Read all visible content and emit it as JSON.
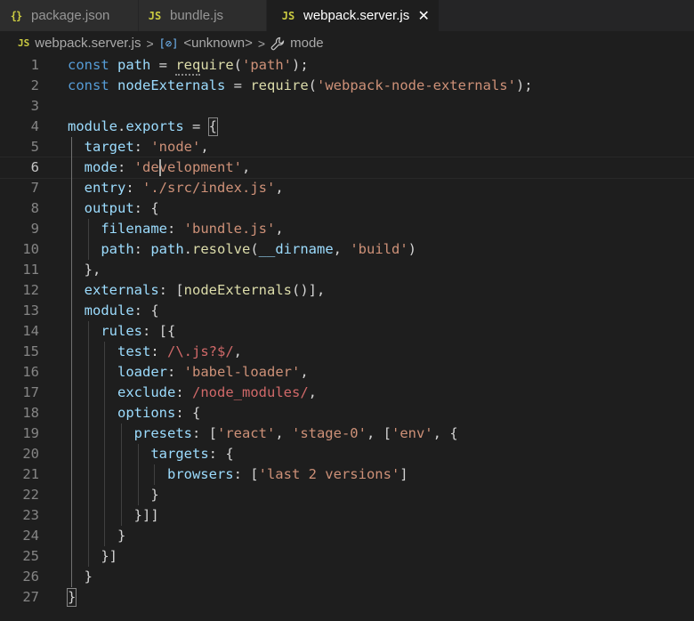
{
  "tabs": [
    {
      "icon": "{}",
      "label": "package.json",
      "active": false
    },
    {
      "icon": "JS",
      "label": "bundle.js",
      "active": false
    },
    {
      "icon": "JS",
      "label": "webpack.server.js",
      "active": true,
      "close": "✕"
    }
  ],
  "breadcrumb": {
    "file_icon": "JS",
    "file": "webpack.server.js",
    "symbol": "<unknown>",
    "property": "mode"
  },
  "editor": {
    "current_line": 6,
    "lines": [
      {
        "n": "1",
        "tokens": [
          [
            "kw",
            "const "
          ],
          [
            "var",
            "path"
          ],
          [
            "p",
            " = "
          ],
          [
            "fn",
            "require"
          ],
          [
            "p",
            "("
          ],
          [
            "str",
            "'path'"
          ],
          [
            "p",
            ");"
          ]
        ]
      },
      {
        "n": "2",
        "tokens": [
          [
            "kw",
            "const "
          ],
          [
            "var",
            "nodeExternals"
          ],
          [
            "p",
            " = "
          ],
          [
            "fn",
            "require"
          ],
          [
            "p",
            "("
          ],
          [
            "str",
            "'webpack-node-externals'"
          ],
          [
            "p",
            ");"
          ]
        ]
      },
      {
        "n": "3",
        "tokens": []
      },
      {
        "n": "4",
        "tokens": [
          [
            "var",
            "module"
          ],
          [
            "p",
            "."
          ],
          [
            "var",
            "exports"
          ],
          [
            "p",
            " = {"
          ]
        ]
      },
      {
        "n": "5",
        "tokens": [
          [
            "p",
            "  "
          ],
          [
            "var",
            "target"
          ],
          [
            "p",
            ": "
          ],
          [
            "str",
            "'node'"
          ],
          [
            "p",
            ","
          ]
        ]
      },
      {
        "n": "6",
        "tokens": [
          [
            "p",
            "  "
          ],
          [
            "var",
            "mode"
          ],
          [
            "p",
            ": "
          ],
          [
            "str",
            "'development'"
          ],
          [
            "p",
            ","
          ]
        ]
      },
      {
        "n": "7",
        "tokens": [
          [
            "p",
            "  "
          ],
          [
            "var",
            "entry"
          ],
          [
            "p",
            ": "
          ],
          [
            "str",
            "'./src/index.js'"
          ],
          [
            "p",
            ","
          ]
        ]
      },
      {
        "n": "8",
        "tokens": [
          [
            "p",
            "  "
          ],
          [
            "var",
            "output"
          ],
          [
            "p",
            ": {"
          ]
        ]
      },
      {
        "n": "9",
        "tokens": [
          [
            "p",
            "    "
          ],
          [
            "var",
            "filename"
          ],
          [
            "p",
            ": "
          ],
          [
            "str",
            "'bundle.js'"
          ],
          [
            "p",
            ","
          ]
        ]
      },
      {
        "n": "10",
        "tokens": [
          [
            "p",
            "    "
          ],
          [
            "var",
            "path"
          ],
          [
            "p",
            ": "
          ],
          [
            "var",
            "path"
          ],
          [
            "p",
            "."
          ],
          [
            "fn",
            "resolve"
          ],
          [
            "p",
            "("
          ],
          [
            "var",
            "__dirname"
          ],
          [
            "p",
            ", "
          ],
          [
            "str",
            "'build'"
          ],
          [
            "p",
            ")"
          ]
        ]
      },
      {
        "n": "11",
        "tokens": [
          [
            "p",
            "  },"
          ]
        ]
      },
      {
        "n": "12",
        "tokens": [
          [
            "p",
            "  "
          ],
          [
            "var",
            "externals"
          ],
          [
            "p",
            ": ["
          ],
          [
            "fn",
            "nodeExternals"
          ],
          [
            "p",
            "()],"
          ]
        ]
      },
      {
        "n": "13",
        "tokens": [
          [
            "p",
            "  "
          ],
          [
            "var",
            "module"
          ],
          [
            "p",
            ": {"
          ]
        ]
      },
      {
        "n": "14",
        "tokens": [
          [
            "p",
            "    "
          ],
          [
            "var",
            "rules"
          ],
          [
            "p",
            ": [{"
          ]
        ]
      },
      {
        "n": "15",
        "tokens": [
          [
            "p",
            "      "
          ],
          [
            "var",
            "test"
          ],
          [
            "p",
            ": "
          ],
          [
            "re",
            "/\\.js?$/"
          ],
          [
            "p",
            ","
          ]
        ]
      },
      {
        "n": "16",
        "tokens": [
          [
            "p",
            "      "
          ],
          [
            "var",
            "loader"
          ],
          [
            "p",
            ": "
          ],
          [
            "str",
            "'babel-loader'"
          ],
          [
            "p",
            ","
          ]
        ]
      },
      {
        "n": "17",
        "tokens": [
          [
            "p",
            "      "
          ],
          [
            "var",
            "exclude"
          ],
          [
            "p",
            ": "
          ],
          [
            "re",
            "/node_modules/"
          ],
          [
            "p",
            ","
          ]
        ]
      },
      {
        "n": "18",
        "tokens": [
          [
            "p",
            "      "
          ],
          [
            "var",
            "options"
          ],
          [
            "p",
            ": {"
          ]
        ]
      },
      {
        "n": "19",
        "tokens": [
          [
            "p",
            "        "
          ],
          [
            "var",
            "presets"
          ],
          [
            "p",
            ": ["
          ],
          [
            "str",
            "'react'"
          ],
          [
            "p",
            ", "
          ],
          [
            "str",
            "'stage-0'"
          ],
          [
            "p",
            ", ["
          ],
          [
            "str",
            "'env'"
          ],
          [
            "p",
            ", {"
          ]
        ]
      },
      {
        "n": "20",
        "tokens": [
          [
            "p",
            "          "
          ],
          [
            "var",
            "targets"
          ],
          [
            "p",
            ": {"
          ]
        ]
      },
      {
        "n": "21",
        "tokens": [
          [
            "p",
            "            "
          ],
          [
            "var",
            "browsers"
          ],
          [
            "p",
            ": ["
          ],
          [
            "str",
            "'last 2 versions'"
          ],
          [
            "p",
            "]"
          ]
        ]
      },
      {
        "n": "22",
        "tokens": [
          [
            "p",
            "          }"
          ]
        ]
      },
      {
        "n": "23",
        "tokens": [
          [
            "p",
            "        }]]"
          ]
        ]
      },
      {
        "n": "24",
        "tokens": [
          [
            "p",
            "      }"
          ]
        ]
      },
      {
        "n": "25",
        "tokens": [
          [
            "p",
            "    }]"
          ]
        ]
      },
      {
        "n": "26",
        "tokens": [
          [
            "p",
            "  }"
          ]
        ]
      },
      {
        "n": "27",
        "tokens": [
          [
            "p",
            "}"
          ]
        ]
      }
    ]
  },
  "colors": {
    "background": "#1e1e1e",
    "keyword": "#569cd6",
    "variable": "#9cdcfe",
    "function": "#dcdcaa",
    "string": "#ce9178",
    "regex": "#d16969"
  }
}
